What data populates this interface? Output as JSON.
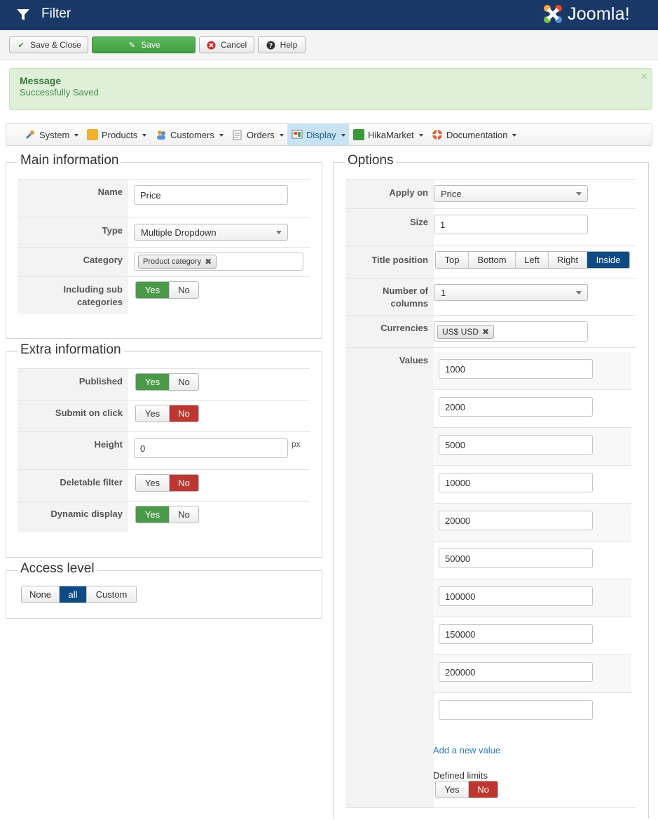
{
  "header": {
    "title": "Filter",
    "logo_text": "Joomla!"
  },
  "toolbar": {
    "save_close": "Save & Close",
    "save": "Save",
    "cancel": "Cancel",
    "help": "Help"
  },
  "message": {
    "title": "Message",
    "text": "Successfully Saved",
    "close": "×"
  },
  "menu": [
    {
      "label": "System"
    },
    {
      "label": "Products"
    },
    {
      "label": "Customers"
    },
    {
      "label": "Orders"
    },
    {
      "label": "Display",
      "active": true
    },
    {
      "label": "HikaMarket"
    },
    {
      "label": "Documentation"
    }
  ],
  "main_info": {
    "legend": "Main information",
    "name_label": "Name",
    "name_value": "Price",
    "type_label": "Type",
    "type_value": "Multiple Dropdown",
    "category_label": "Category",
    "category_tag": "Product category",
    "subcat_label_1": "Including sub",
    "subcat_label_2": "categories",
    "subcat_yes": "Yes",
    "subcat_no": "No"
  },
  "extra_info": {
    "legend": "Extra information",
    "published_label": "Published",
    "published_yes": "Yes",
    "published_no": "No",
    "submit_label": "Submit on click",
    "submit_yes": "Yes",
    "submit_no": "No",
    "height_label": "Height",
    "height_value": "0",
    "height_unit": "px",
    "deletable_label": "Deletable filter",
    "deletable_yes": "Yes",
    "deletable_no": "No",
    "dynamic_label": "Dynamic display",
    "dynamic_yes": "Yes",
    "dynamic_no": "No"
  },
  "access": {
    "legend": "Access level",
    "none": "None",
    "all": "all",
    "custom": "Custom"
  },
  "options": {
    "legend": "Options",
    "apply_label": "Apply on",
    "apply_value": "Price",
    "size_label": "Size",
    "size_value": "1",
    "title_pos_label": "Title position",
    "title_pos": [
      "Top",
      "Bottom",
      "Left",
      "Right",
      "Inside"
    ],
    "title_pos_selected": "Inside",
    "columns_label_1": "Number of",
    "columns_label_2": "columns",
    "columns_value": "1",
    "currencies_label": "Currencies",
    "currency_tag": "US$ USD",
    "values_label": "Values",
    "values": [
      "1000",
      "2000",
      "5000",
      "10000",
      "20000",
      "50000",
      "100000",
      "150000",
      "200000",
      ""
    ],
    "add_value": "Add a new value",
    "defined_limits_label": "Defined limits",
    "defined_yes": "Yes",
    "defined_no": "No"
  },
  "colors": {
    "header_bg": "#1a3867",
    "success_green": "#4a9a4a",
    "danger_red": "#bd362f",
    "selected_blue": "#0e4a84"
  }
}
